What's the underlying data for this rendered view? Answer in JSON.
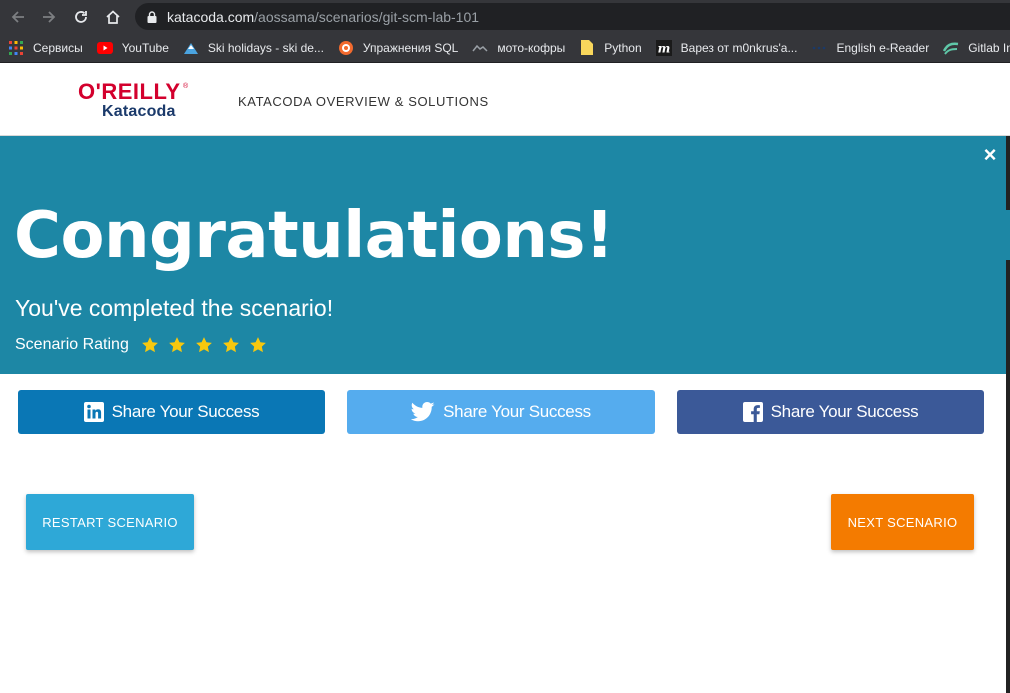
{
  "browser": {
    "url_domain": "katacoda.com",
    "url_path": "/aossama/scenarios/git-scm-lab-101",
    "nav": [
      "back-icon",
      "forward-icon",
      "reload-icon",
      "home-icon"
    ],
    "bookmarks": [
      {
        "label": "Сервисы",
        "icon": "apps-grid-icon"
      },
      {
        "label": "YouTube",
        "icon": "youtube-icon"
      },
      {
        "label": "Ski holidays - ski de...",
        "icon": "ski-icon"
      },
      {
        "label": "Упражнения SQL",
        "icon": "sql-icon"
      },
      {
        "label": "мото-кофры",
        "icon": "moto-icon"
      },
      {
        "label": "Python",
        "icon": "bookmark-file-icon"
      },
      {
        "label": "Варез от m0nkrus'a...",
        "icon": "m-icon"
      },
      {
        "label": "English e-Reader",
        "icon": "dots-icon"
      },
      {
        "label": "Gitlab In",
        "icon": "gitlab-icon"
      }
    ]
  },
  "header": {
    "logo_top": "O'REILLY",
    "logo_reg": "®",
    "logo_bottom": "Katacoda",
    "nav_label": "KATACODA OVERVIEW & SOLUTIONS"
  },
  "modal": {
    "close_symbol": "×",
    "title": "Congratulations!",
    "subtitle": "You've completed the scenario!",
    "rating_label": "Scenario Rating",
    "rating": 5,
    "rating_max": 5,
    "share": [
      {
        "label": "Share Your Success",
        "network": "linkedin",
        "color": "#0a77b5"
      },
      {
        "label": "Share Your Success",
        "network": "twitter",
        "color": "#55acee"
      },
      {
        "label": "Share Your Success",
        "network": "facebook",
        "color": "#3b5998"
      }
    ],
    "restart_label": "RESTART SCENARIO",
    "next_label": "NEXT SCENARIO"
  },
  "colors": {
    "banner": "#1d87a5",
    "star": "#f7c80e",
    "restart": "#2ea8d7",
    "next": "#f47b00",
    "chrome": "#35363a"
  }
}
